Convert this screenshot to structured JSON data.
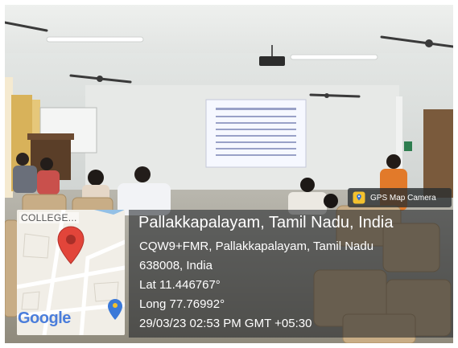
{
  "badge": {
    "label": "GPS Map Camera",
    "icon": "gps-map-camera-icon"
  },
  "map": {
    "label": "COLLEGE...",
    "logo": "Google",
    "pin_color": "#e2453a"
  },
  "location": {
    "title": "Pallakkapalayam, Tamil Nadu, India",
    "address_line1": "CQW9+FMR, Pallakkapalayam, Tamil Nadu",
    "address_line2": "638008, India",
    "latitude": "Lat 11.446767°",
    "longitude": "Long 77.76992°",
    "datetime": "29/03/23 02:53 PM GMT +05:30"
  }
}
